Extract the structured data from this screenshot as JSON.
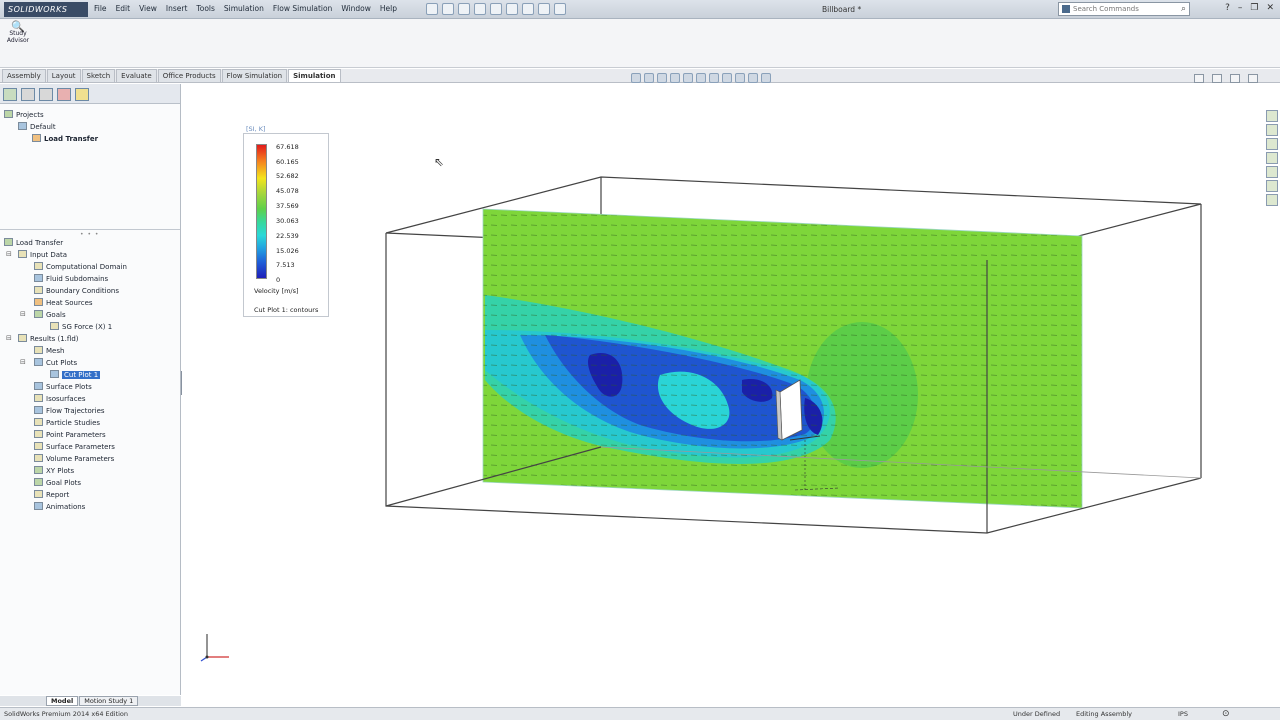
{
  "app": {
    "brand": "SOLIDWORKS",
    "document_title": "Billboard *",
    "search_placeholder": "Search Commands"
  },
  "menu": [
    "File",
    "Edit",
    "View",
    "Insert",
    "Tools",
    "Simulation",
    "Flow Simulation",
    "Window",
    "Help"
  ],
  "command_manager": {
    "study_advisor_line1": "Study",
    "study_advisor_line2": "Advisor"
  },
  "tabs": [
    "Assembly",
    "Layout",
    "Sketch",
    "Evaluate",
    "Office Products",
    "Flow Simulation",
    "Simulation"
  ],
  "active_tab": "Simulation",
  "projects_tree": {
    "root": "Projects",
    "config": "Default",
    "project": "Load Transfer"
  },
  "analysis_tree": {
    "root": "Load Transfer",
    "input_data": "Input Data",
    "input_items": [
      "Computational Domain",
      "Fluid Subdomains",
      "Boundary Conditions",
      "Heat Sources",
      "Goals"
    ],
    "goal_item": "SG Force (X) 1",
    "results": "Results (1.fld)",
    "result_items": [
      "Mesh",
      "Cut Plots",
      "Surface Plots",
      "Isosurfaces",
      "Flow Trajectories",
      "Particle Studies",
      "Point Parameters",
      "Surface Parameters",
      "Volume Parameters",
      "XY Plots",
      "Goal Plots",
      "Report",
      "Animations"
    ],
    "selected_item": "Cut Plot 1"
  },
  "bottom_tabs": [
    "Model",
    "Motion Study 1"
  ],
  "legend": {
    "header": "[SI, K]",
    "values": [
      "67.618",
      "60.165",
      "52.682",
      "45.078",
      "37.569",
      "30.063",
      "22.539",
      "15.026",
      "7.513",
      "0"
    ],
    "unit_label": "Velocity [m/s]",
    "plot_name": "Cut Plot 1: contours",
    "colors": [
      "#e21b1b",
      "#f5801f",
      "#f4e41c",
      "#a8d63c",
      "#5fd04a",
      "#37d89c",
      "#2bd8d8",
      "#22a0e0",
      "#1f5fd8",
      "#1f1fb8"
    ]
  },
  "status": {
    "edition": "SolidWorks Premium 2014 x64 Edition",
    "state": "Under Defined",
    "mode": "Editing Assembly",
    "units": "IPS"
  }
}
